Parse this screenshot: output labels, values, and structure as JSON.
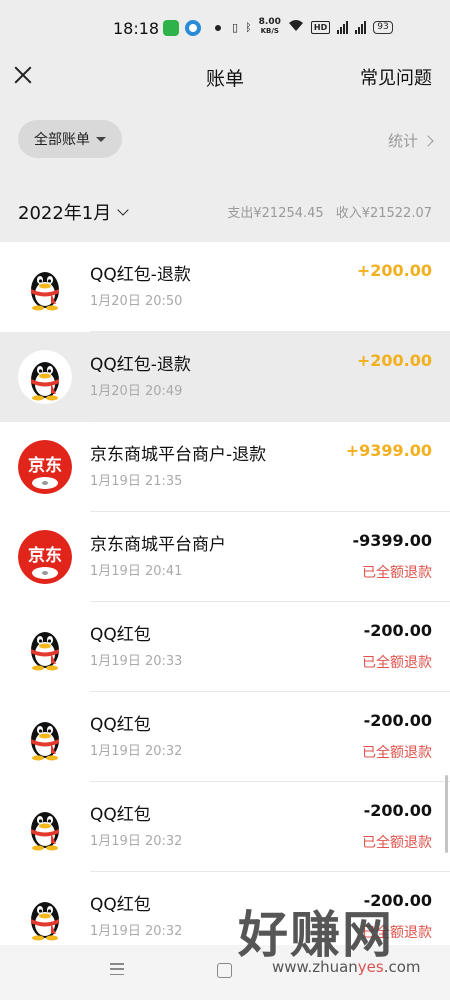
{
  "status_bar": {
    "time": "18:18",
    "net_speed": "8.00",
    "net_unit": "KB/S",
    "hd_badge": "HD",
    "signal1_label": "4G",
    "signal2_label": "4G",
    "battery": "93"
  },
  "nav": {
    "title": "账单",
    "faq_label": "常见问题"
  },
  "filter": {
    "label": "全部账单",
    "stats_label": "统计"
  },
  "month_summary": {
    "month": "2022年1月",
    "expense": "支出¥21254.45",
    "income": "收入¥21522.07"
  },
  "transactions": [
    {
      "title": "QQ红包-退款",
      "time": "1月20日 20:50",
      "amount": "+200.00",
      "status": "",
      "icon": "qq-penguin-icon",
      "kind": "income"
    },
    {
      "title": "QQ红包-退款",
      "time": "1月20日 20:49",
      "amount": "+200.00",
      "status": "",
      "icon": "qq-penguin-icon",
      "kind": "income"
    },
    {
      "title": "京东商城平台商户-退款",
      "time": "1月19日 21:35",
      "amount": "+9399.00",
      "status": "",
      "icon": "jd-logo-icon",
      "kind": "income"
    },
    {
      "title": "京东商城平台商户",
      "time": "1月19日 20:41",
      "amount": "-9399.00",
      "status": "已全额退款",
      "icon": "jd-logo-icon",
      "kind": "expense"
    },
    {
      "title": "QQ红包",
      "time": "1月19日 20:33",
      "amount": "-200.00",
      "status": "已全额退款",
      "icon": "qq-penguin-icon",
      "kind": "expense"
    },
    {
      "title": "QQ红包",
      "time": "1月19日 20:32",
      "amount": "-200.00",
      "status": "已全额退款",
      "icon": "qq-penguin-icon",
      "kind": "expense"
    },
    {
      "title": "QQ红包",
      "time": "1月19日 20:32",
      "amount": "-200.00",
      "status": "已全额退款",
      "icon": "qq-penguin-icon",
      "kind": "expense"
    },
    {
      "title": "QQ红包",
      "time": "1月19日 20:32",
      "amount": "-200.00",
      "status": "已全额退款",
      "icon": "qq-penguin-icon",
      "kind": "expense"
    }
  ],
  "watermark": {
    "main": "好赚网",
    "sub_prefix": "www.zhuan",
    "sub_highlight": "yes",
    "sub_suffix": ".com"
  },
  "colors": {
    "income": "#f2b01e",
    "refund_status": "#e0524b",
    "jd_red": "#e1251b",
    "qq_scarf": "#e23a2e"
  }
}
